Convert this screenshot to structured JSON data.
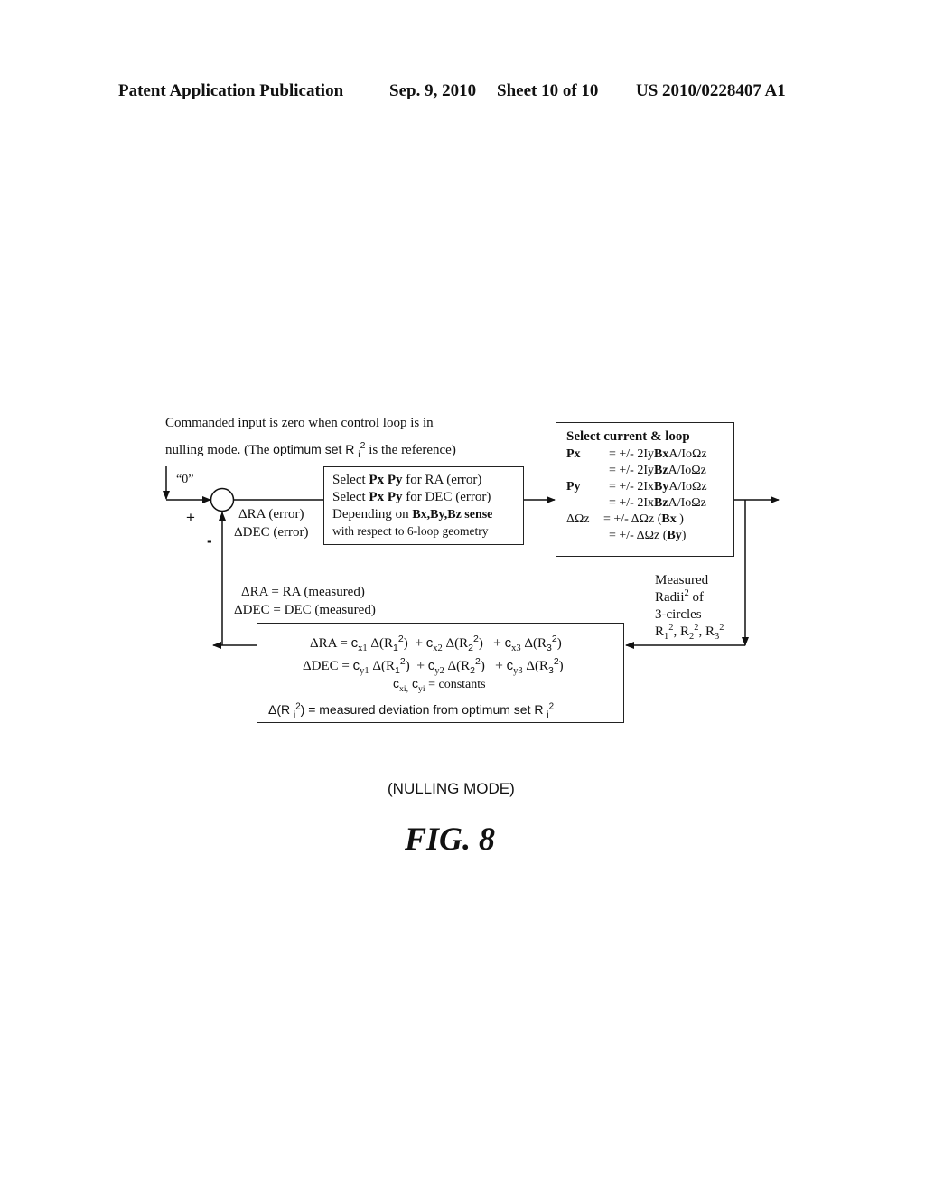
{
  "header": {
    "publication": "Patent Application Publication",
    "date": "Sep. 9, 2010",
    "sheet": "Sheet 10 of 10",
    "number": "US 2010/0228407 A1"
  },
  "note": {
    "line1": "Commanded input is zero when control loop is in",
    "line2_prefix": "nulling mode. (The ",
    "line2_mid": "optimum set R ",
    "line2_sub": "i",
    "line2_sup": "2",
    "line2_suffix": " is the reference)"
  },
  "input": {
    "label": "“0”",
    "plus": "+",
    "minus": "-"
  },
  "error_labels": {
    "ra": "ΔRA (error)",
    "dec": "ΔDEC (error)"
  },
  "select_box": {
    "l1_a": "Select ",
    "l1_b": "Px Py",
    "l1_c": " for RA (error)",
    "l2_a": "Select ",
    "l2_b": "Px Py",
    "l2_c": " for DEC (error)",
    "l3_a": "Depending on ",
    "l3_b": "Bx,By,Bz  sense",
    "l4": "with respect to 6-loop geometry"
  },
  "current_box": {
    "title": "Select current & loop",
    "px_label": "Px",
    "px1_a": "= +/- 2Iy",
    "px1_b": "Bx",
    "px1_c": "A/IoΩz",
    "px2_a": "= +/- 2Iy",
    "px2_b": "Bz",
    "px2_c": "A/IoΩz",
    "py_label": "Py",
    "py1_a": "= +/- 2Ix",
    "py1_b": "By",
    "py1_c": "A/IoΩz",
    "py2_a": "= +/- 2Ix",
    "py2_b": "Bz",
    "py2_c": "A/IoΩz",
    "dz_label": "ΔΩz",
    "dz1_a": "= +/- ΔΩz (",
    "dz1_b": "Bx",
    "dz1_c": " )",
    "dz2_a": "= +/- ΔΩz (",
    "dz2_b": "By",
    "dz2_c": ")"
  },
  "measured_labels": {
    "ra": "ΔRA =   RA (measured)",
    "dec": "ΔDEC = DEC (measured)"
  },
  "radii_label": {
    "l1": "Measured",
    "l2": "Radii",
    "l2_sup": "2",
    "l2_tail": " of",
    "l3": "3-circles",
    "r": "R",
    "s1": "1",
    "s2": "2",
    "s3": "3",
    "sq": "2"
  },
  "equation_box": {
    "ra_lhs": "ΔRA =",
    "dec_lhs": "ΔDEC =",
    "c_x1": "x1",
    "c_x2": "x2",
    "c_x3": "x3",
    "c_y1": "y1",
    "c_y2": "y2",
    "c_y3": "y3",
    "c": "c",
    "delta_r": "Δ(R",
    "i1": "1",
    "i2": "2",
    "i3": "3",
    "sq": "2",
    "plus": "+",
    "constants_a": "c",
    "constants_xi": "xi,",
    "constants_b": " c",
    "constants_yi": "yi",
    "constants_c": " = constants",
    "dev_a": "Δ(R ",
    "dev_i": "i",
    "dev_sq": "2",
    "dev_b": ")  =  measured deviation from optimum set R ",
    "dev_i2": "i",
    "dev_sq2": "2"
  },
  "caption": "(NULLING MODE)",
  "figure_label": "FIG. 8"
}
